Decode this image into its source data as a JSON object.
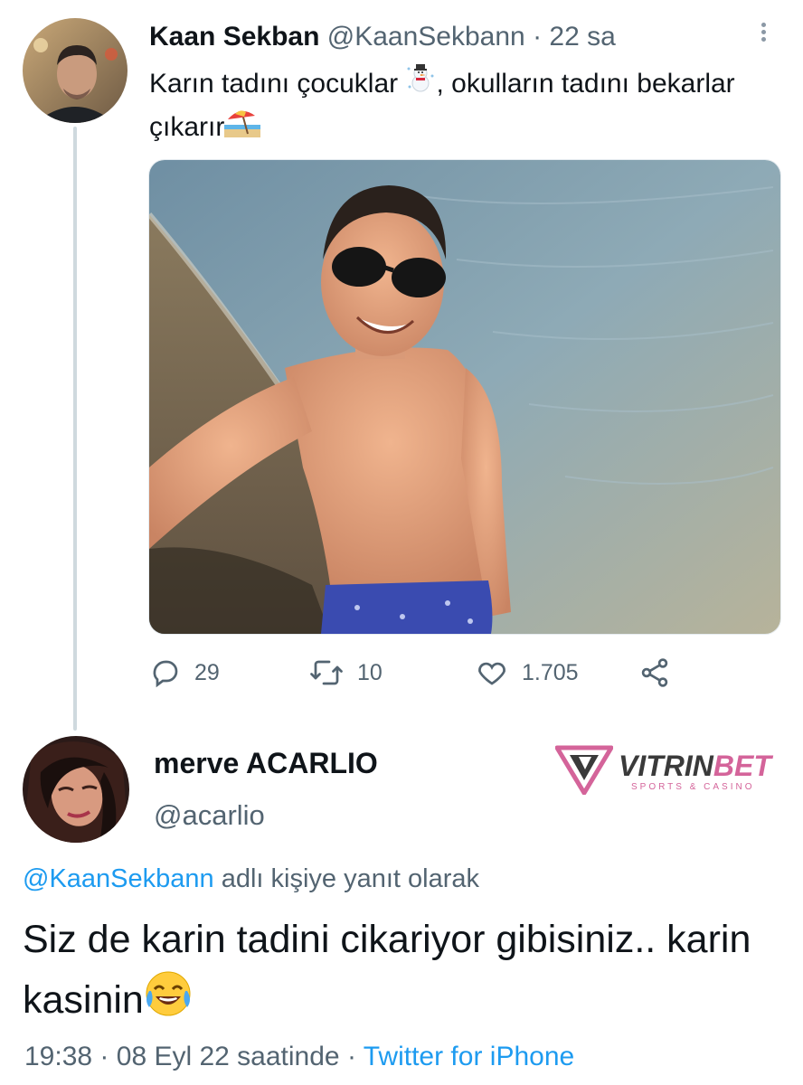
{
  "tweet": {
    "author_name": "Kaan Sekban",
    "author_handle": "@KaanSekbann",
    "separator": "·",
    "time_ago": "22 sa",
    "text_part1": "Karın tadını çocuklar ",
    "text_part2": ", okulların tadını bekarlar çıkarır",
    "emoji_1": "snowman-icon",
    "emoji_2": "beach-umbrella-icon",
    "image": "selfie-on-beach-photo",
    "stats": {
      "replies": "29",
      "retweets": "10",
      "likes": "1.705"
    }
  },
  "reply": {
    "author_name": "merve ACARLIO",
    "author_handle": "@acarlio",
    "reply_context_mention": "@KaanSekbann",
    "reply_context_suffix": " adlı kişiye yanıt olarak",
    "text": "Siz de karin tadini cikariyor gibisiniz.. karin kasinin",
    "emoji": "face-with-tears-of-joy-icon",
    "time": "19:38",
    "date": "08 Eyl 22 saatinde",
    "separator": "·",
    "source": "Twitter for iPhone"
  },
  "watermark": {
    "brand_part1": "VITRIN",
    "brand_part2": "BET",
    "tagline": "SPORTS & CASINO"
  },
  "colors": {
    "link": "#1d9bf0",
    "secondary_text": "#536471",
    "primary_text": "#0f1419",
    "thread_line": "#cfd9de",
    "brand_pink": "#d4649a"
  }
}
